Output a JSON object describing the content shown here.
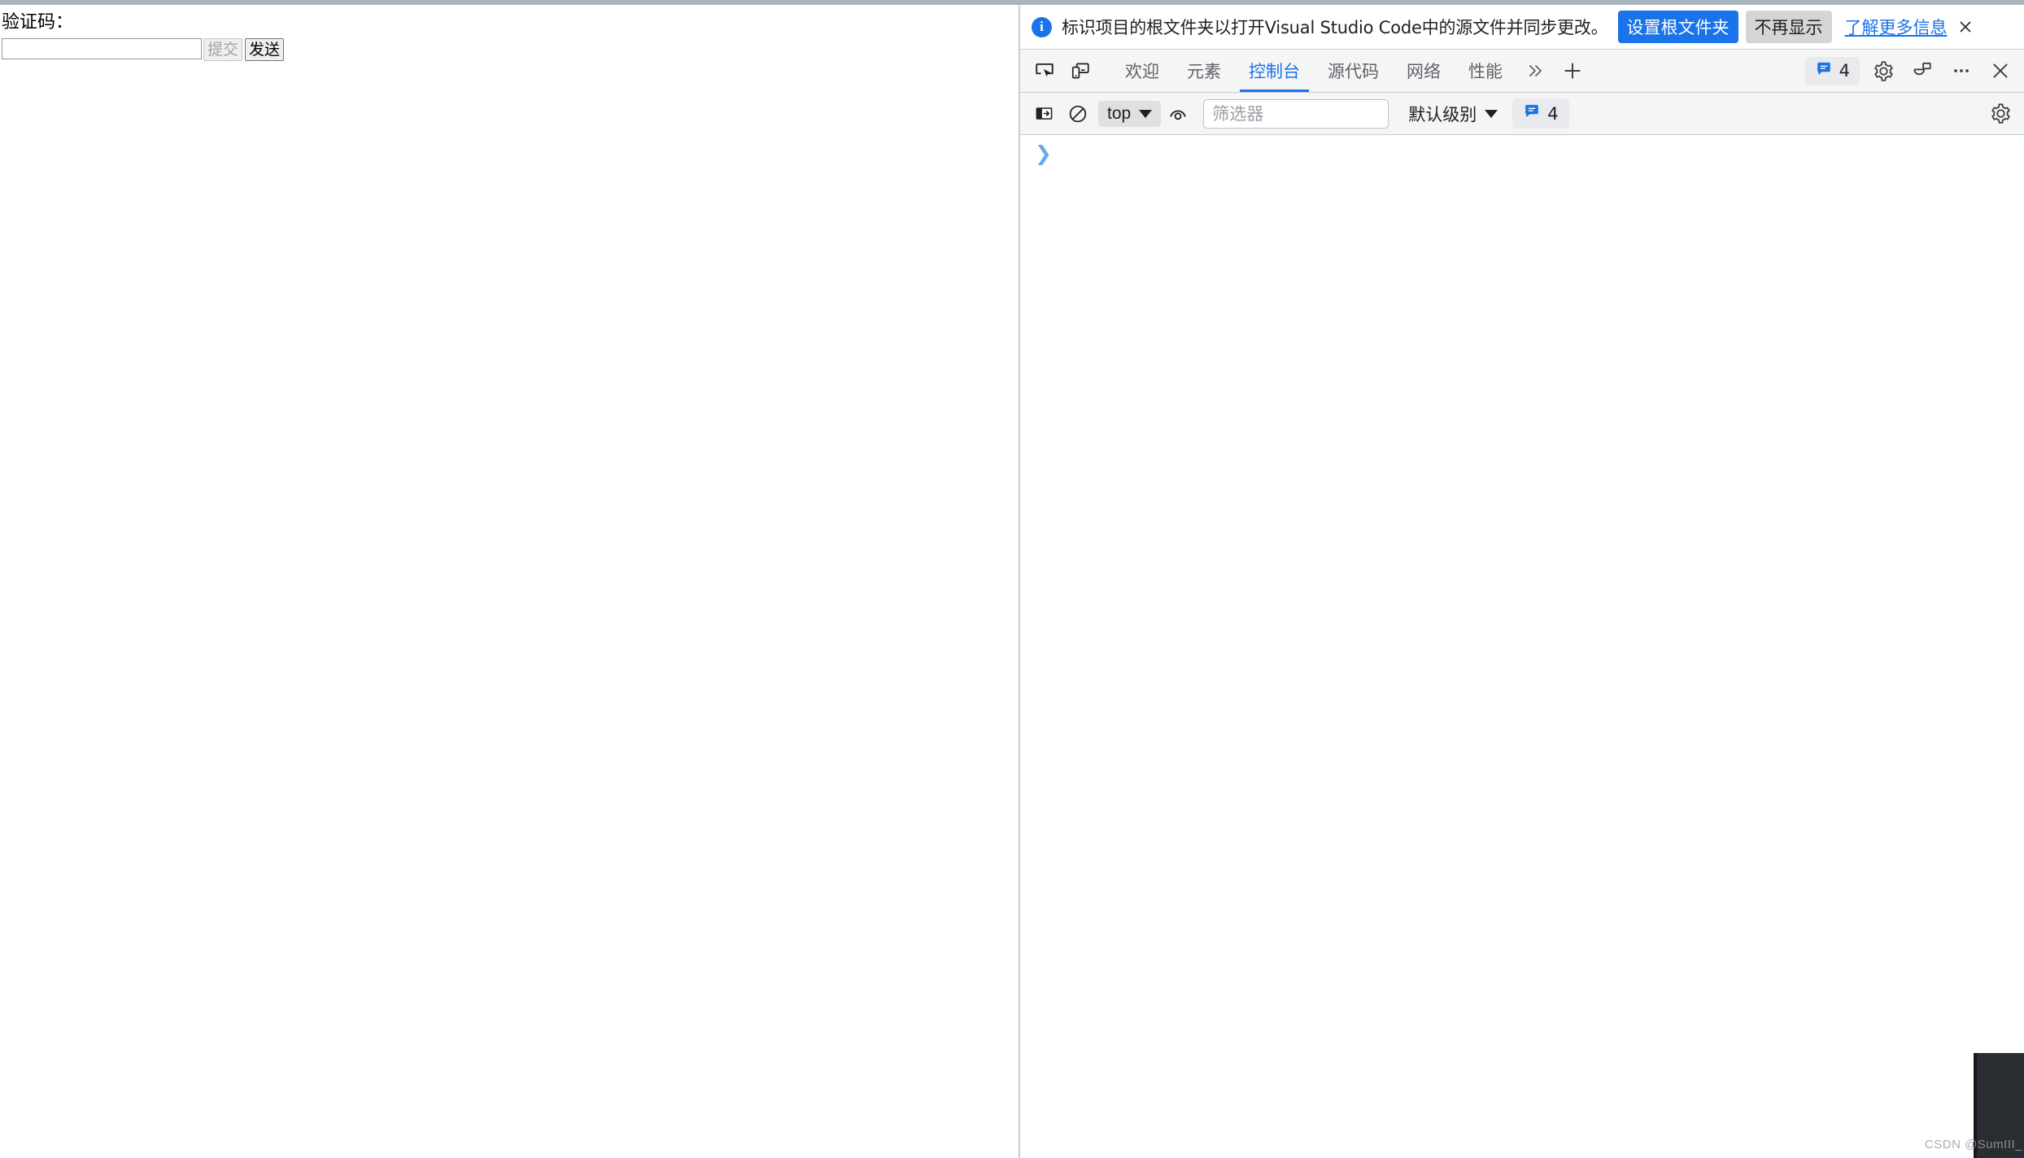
{
  "page": {
    "captcha_label": "验证码：",
    "captcha_input_value": "",
    "captcha_input_placeholder": "",
    "submit_label": "提交",
    "send_label": "发送"
  },
  "devtools": {
    "infobar": {
      "icon": "info-icon",
      "message": "标识项目的根文件夹以打开Visual Studio Code中的源文件并同步更改。",
      "primary_button": "设置根文件夹",
      "secondary_button": "不再显示",
      "link": "了解更多信息",
      "close_icon": "close-icon"
    },
    "tabbar": {
      "inspect_icon": "inspect-element-icon",
      "device_icon": "device-toolbar-icon",
      "tabs": [
        {
          "label": "欢迎",
          "active": false
        },
        {
          "label": "元素",
          "active": false
        },
        {
          "label": "控制台",
          "active": true
        },
        {
          "label": "源代码",
          "active": false
        },
        {
          "label": "网络",
          "active": false
        },
        {
          "label": "性能",
          "active": false
        }
      ],
      "more_tabs_icon": "chevron-double-right-icon",
      "add_tab_icon": "plus-icon",
      "issues_count": "4",
      "issues_icon": "issues-bubble-icon",
      "settings_icon": "gear-icon",
      "customize_icon": "dock-side-icon",
      "more_options_icon": "ellipsis-icon",
      "close_icon": "close-icon"
    },
    "console_toolbar": {
      "sidebar_icon": "console-sidebar-icon",
      "clear_icon": "clear-console-icon",
      "context_value": "top",
      "context_caret_icon": "caret-down-icon",
      "live_expression_icon": "eye-icon",
      "filter_value": "",
      "filter_placeholder": "筛选器",
      "level_value": "默认级别",
      "level_caret_icon": "caret-down-icon",
      "issues_count": "4",
      "issues_icon": "issues-bubble-icon",
      "settings_icon": "gear-icon"
    },
    "console_body": {
      "prompt_symbol": "❯",
      "prompt_value": "",
      "prompt_placeholder": ""
    }
  },
  "watermark": "CSDN @SumIII_"
}
